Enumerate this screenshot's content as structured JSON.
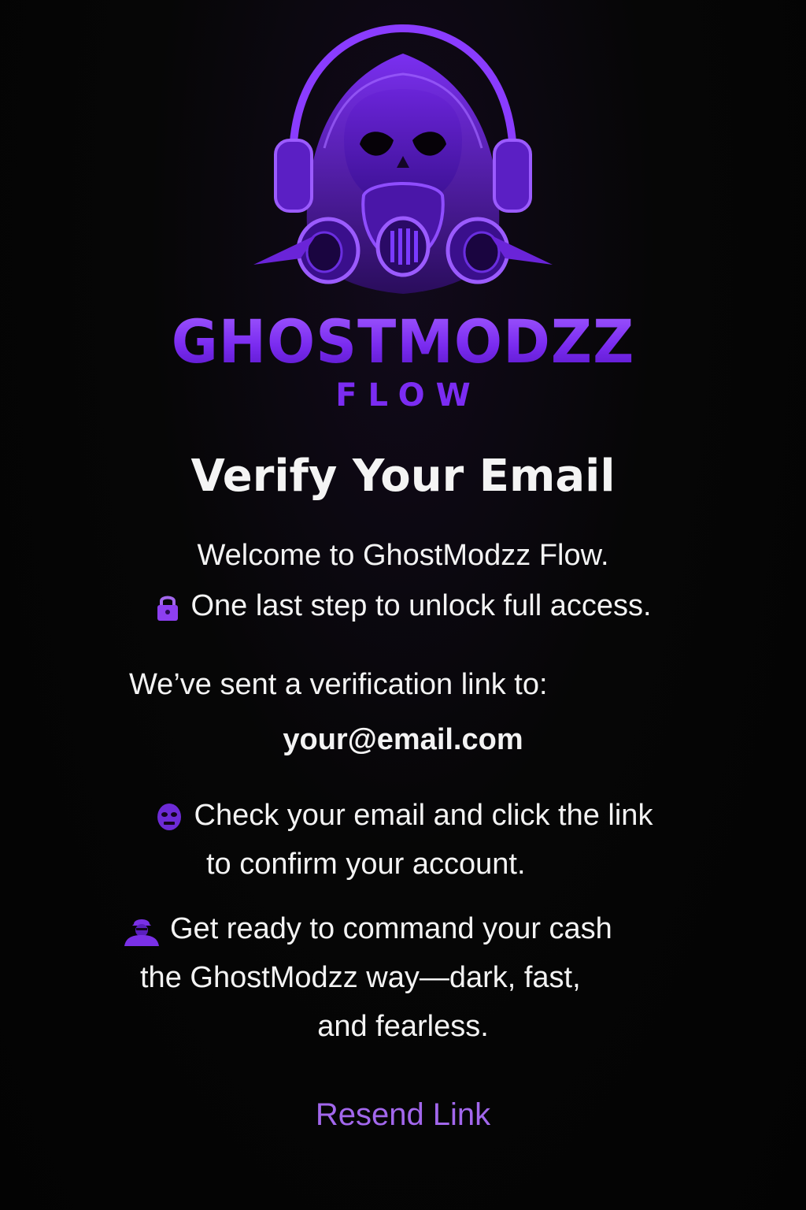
{
  "brand": {
    "name": "GHOSTMODZZ",
    "sub": "FLOW"
  },
  "page": {
    "title": "Verify Your Email"
  },
  "intro": {
    "welcome": "Welcome to GhostModzz Flow.",
    "unlock": "One last step to unlock full access."
  },
  "verification": {
    "sent_text": "We’ve sent a verification link to:",
    "email": "your@email.com"
  },
  "instructions": {
    "check_line1": "Check your email and click the link",
    "check_line2": "to confirm your account.",
    "ready_line1": "Get ready to command your cash",
    "ready_line2": "the GhostModzz way—dark, fast,",
    "ready_line3": "and fearless."
  },
  "actions": {
    "resend_label": "Resend Link"
  },
  "icons": {
    "logo": "gas-mask-skull-headphones-logo",
    "unlock": "lock-icon",
    "check": "skull-face-icon",
    "ready": "hacker-figure-icon"
  },
  "colors": {
    "background": "#050505",
    "accent": "#7b2cf2",
    "link": "#a267ec",
    "text": "#f3f3f3"
  }
}
